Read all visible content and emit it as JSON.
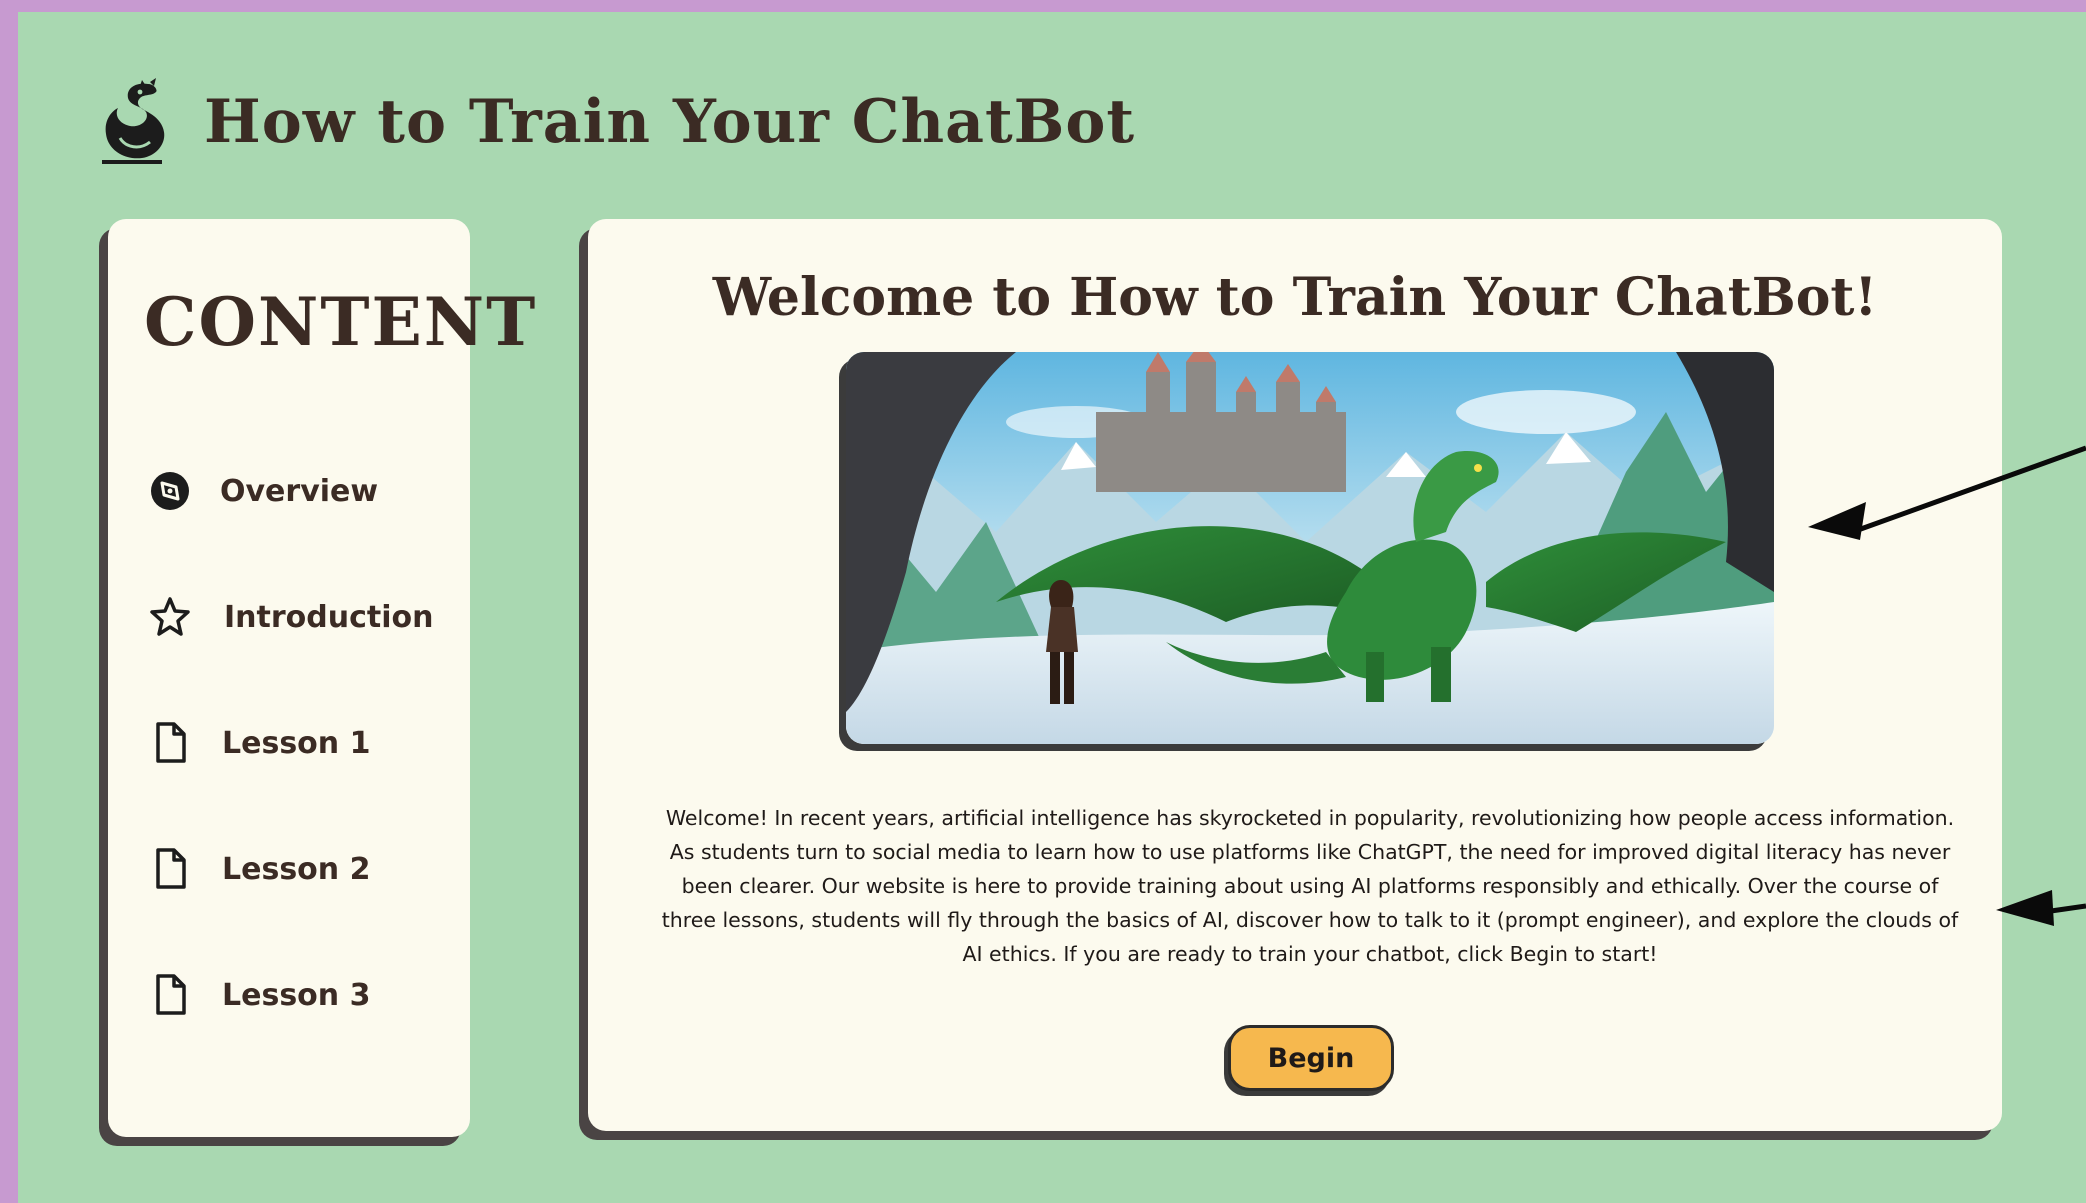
{
  "header": {
    "site_title": "How to Train Your ChatBot",
    "logo_icon": "dragon-logo-icon"
  },
  "sidebar": {
    "heading": "CONTENT",
    "items": [
      {
        "label": "Overview",
        "icon": "compass-icon"
      },
      {
        "label": "Introduction",
        "icon": "star-icon"
      },
      {
        "label": "Lesson 1",
        "icon": "file-icon"
      },
      {
        "label": "Lesson 2",
        "icon": "file-icon"
      },
      {
        "label": "Lesson 3",
        "icon": "file-icon"
      }
    ]
  },
  "main": {
    "title": "Welcome to How to Train Your ChatBot!",
    "hero_image": "girl-and-green-dragon-castle-illustration",
    "welcome_text": "Welcome! In recent years, artificial intelligence has skyrocketed in popularity, revolutionizing how people access information. As students turn to social media to learn how to use platforms like ChatGPT, the need for improved digital literacy has never been clearer. Our website is here to provide training about using AI platforms responsibly and ethically. Over the course of three lessons, students will fly through the basics of AI, discover how to talk to it (prompt engineer), and explore the clouds of AI ethics. If you are ready to train your chatbot, click Begin to start!",
    "begin_label": "Begin"
  },
  "colors": {
    "page_background": "#a9d8b1",
    "outer_border": "#c79ad0",
    "card_background": "#fcfaee",
    "text_dark": "#3b2b24",
    "button_fill": "#f6b84e",
    "shadow": "#4a4444"
  }
}
